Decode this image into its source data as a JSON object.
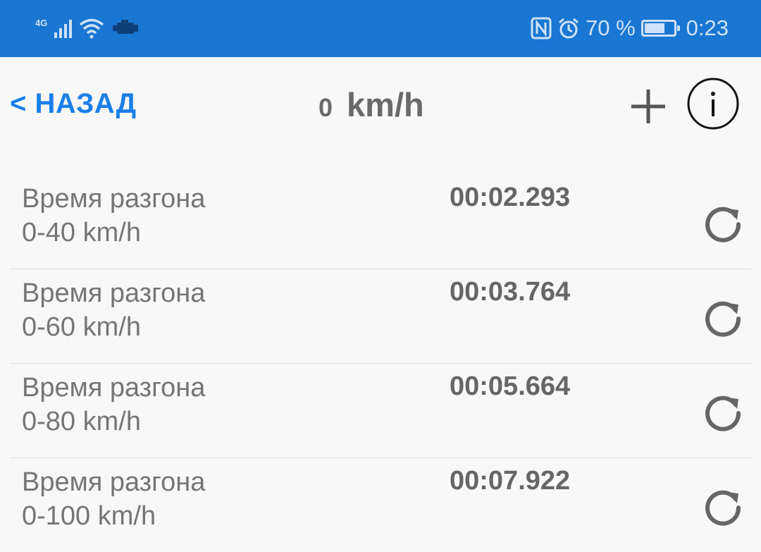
{
  "status_bar": {
    "network_type": "4G",
    "battery_percent": "70 %",
    "battery_level": 0.7,
    "time": "0:23",
    "icons": [
      "signal-icon",
      "wifi-icon",
      "engine-check-icon",
      "nfc-icon",
      "alarm-icon",
      "battery-icon"
    ]
  },
  "toolbar": {
    "back_label": "< НАЗАД",
    "speed_value": "0",
    "speed_unit": "km/h",
    "add_icon": "plus-icon",
    "info_icon": "info-icon"
  },
  "measurements": [
    {
      "title": "Время разгона",
      "range": "0-40 km/h",
      "time": "00:02.293"
    },
    {
      "title": "Время разгона",
      "range": "0-60 km/h",
      "time": "00:03.764"
    },
    {
      "title": "Время разгона",
      "range": "0-80 km/h",
      "time": "00:05.664"
    },
    {
      "title": "Время разгона",
      "range": "0-100 km/h",
      "time": "00:07.922"
    }
  ],
  "colors": {
    "status_bar_bg": "#1976d2",
    "accent_link": "#1a7fe8",
    "text_gray": "#757575",
    "background": "#f8f8f8"
  }
}
